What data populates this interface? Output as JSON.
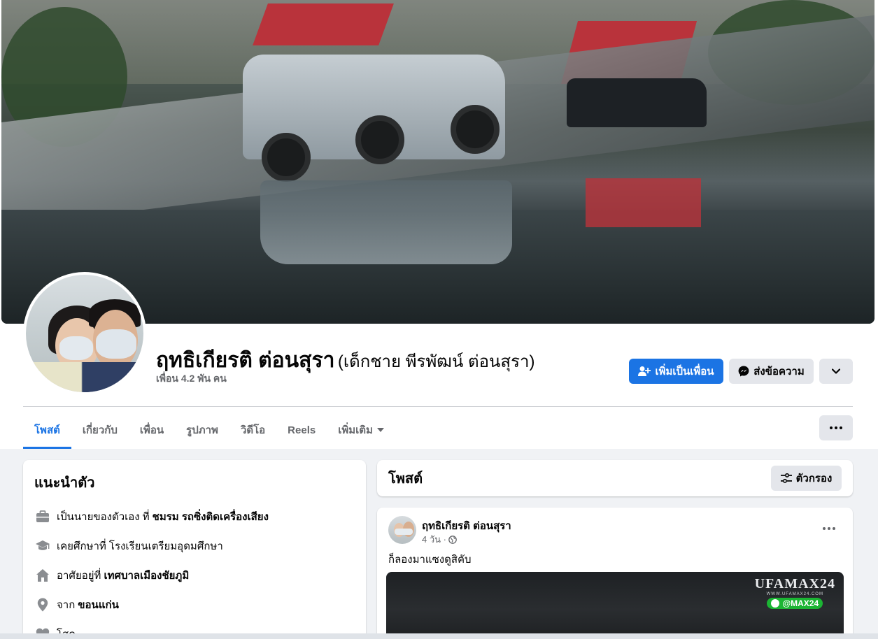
{
  "profile": {
    "name": "ฤทธิเกียรติ ต่อนสุรา",
    "alternate_name": "(เด็กชาย พีรพัฒน์ ต่อนสุรา)",
    "friends_count": "เพื่อน 4.2 พัน คน"
  },
  "actions": {
    "add_friend": "เพิ่มเป็นเพื่อน",
    "message": "ส่งข้อความ"
  },
  "tabs": [
    {
      "label": "โพสต์",
      "active": true
    },
    {
      "label": "เกี่ยวกับ"
    },
    {
      "label": "เพื่อน"
    },
    {
      "label": "รูปภาพ"
    },
    {
      "label": "วิดีโอ"
    },
    {
      "label": "Reels"
    },
    {
      "label": "เพิ่มเติม"
    }
  ],
  "intro": {
    "title": "แนะนำตัว",
    "items": [
      {
        "icon": "briefcase-icon",
        "prefix": "เป็นนายของตัวเอง ที่",
        "value": "ชมรม รถซิ่งติดเครื่องเสียง"
      },
      {
        "icon": "graduation-cap-icon",
        "prefix": "เคยศึกษาที่ โรงเรียนเตรียมอุดมศึกษา",
        "value": ""
      },
      {
        "icon": "home-icon",
        "prefix": "อาศัยอยู่ที่",
        "value": "เทศบาลเมืองชัยภูมิ"
      },
      {
        "icon": "location-pin-icon",
        "prefix": "จาก",
        "value": "ขอนแก่น"
      },
      {
        "icon": "heart-icon",
        "prefix": "โสด",
        "value": ""
      }
    ]
  },
  "posts": {
    "title": "โพสต์",
    "filter_label": "ตัวกรอง",
    "items": [
      {
        "author": "ฤทธิเกียรติ ต่อนสุรา",
        "time": "4 วัน ·",
        "privacy_icon": "globe-icon",
        "text": "ก็ลองมาแซงดูสิคับ",
        "watermark": {
          "brand": "UFAMAX24",
          "site": "WWW.UFAMAX24.COM",
          "line_id": "@MAX24"
        }
      }
    ]
  },
  "colors": {
    "accent": "#1b74e4",
    "secondary_button": "#e4e6eb",
    "page_bg": "#f0f2f5",
    "text_secondary": "#65676b"
  }
}
